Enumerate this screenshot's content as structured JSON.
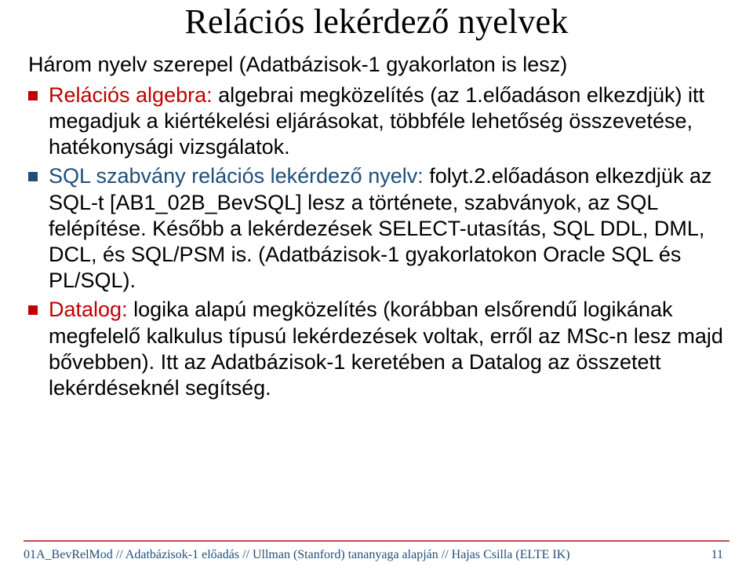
{
  "title": "Relációs lekérdező nyelvek",
  "intro": "Három nyelv szerepel (Adatbázisok-1 gyakorlaton is lesz)",
  "bullets": {
    "b1": {
      "lead": "Relációs algebra:",
      "rest": " algebrai megközelítés (az 1.előadáson elkezdjük) itt megadjuk a kiértékelési eljárásokat, többféle lehetőség összevetése, hatékonysági vizsgálatok."
    },
    "b2": {
      "lead": "SQL szabvány relációs lekérdező nyelv:",
      "rest": " folyt.2.előadáson elkezdjük az SQL-t [AB1_02B_BevSQL] lesz a története, szabványok, az SQL felépítése. Később a lekérdezések SELECT-utasítás, SQL DDL, DML, DCL, és SQL/PSM is. (Adatbázisok-1 gyakorlatokon Oracle SQL és PL/SQL)."
    },
    "b3": {
      "lead": "Datalog:",
      "rest": " logika alapú megközelítés (korábban elsőrendű logikának megfelelő kalkulus típusú lekérdezések voltak, erről az MSc-n lesz majd bővebben). Itt az Adatbázisok-1 keretében a Datalog az összetett lekérdéseknél segítség."
    }
  },
  "footer": {
    "text": "01A_BevRelMod // Adatbázisok-1 előadás // Ullman (Stanford) tananyaga alapján // Hajas Csilla (ELTE IK)",
    "page": "11"
  }
}
